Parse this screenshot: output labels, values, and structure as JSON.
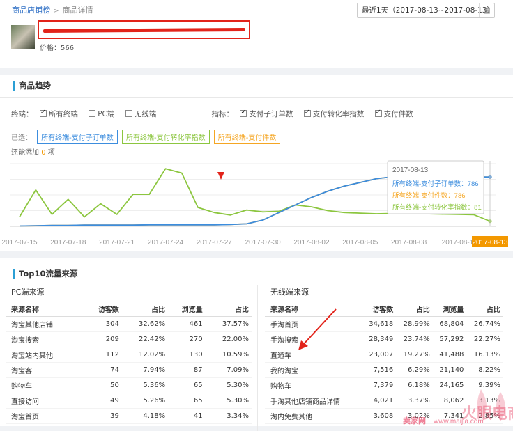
{
  "breadcrumb": {
    "root": "商品店铺榜",
    "current": "商品详情"
  },
  "date_range": "最近1天（2017-08-13~2017-08-13）",
  "product": {
    "price": "价格：566"
  },
  "trend": {
    "title": "商品趋势",
    "terminal_label": "终端：",
    "terminals": [
      {
        "label": "所有终端",
        "checked": true
      },
      {
        "label": "PC端",
        "checked": false
      },
      {
        "label": "无线端",
        "checked": false
      }
    ],
    "metric_label": "指标：",
    "metrics": [
      {
        "label": "支付子订单数",
        "checked": true
      },
      {
        "label": "支付转化率指数",
        "checked": true
      },
      {
        "label": "支付件数",
        "checked": true
      }
    ],
    "selected_label": "已选：",
    "selected": [
      {
        "label": "所有终端-支付子订单数",
        "color": "#3c8dde"
      },
      {
        "label": "所有终端-支付转化率指数",
        "color": "#8cc63f"
      },
      {
        "label": "所有终端-支付件数",
        "color": "#f5a623"
      }
    ],
    "addmore_prefix": "还能添加",
    "addmore_count": "0",
    "addmore_suffix": "项"
  },
  "chart_data": {
    "type": "line",
    "x": [
      "2017-07-15",
      "2017-07-16",
      "2017-07-17",
      "2017-07-18",
      "2017-07-19",
      "2017-07-20",
      "2017-07-21",
      "2017-07-22",
      "2017-07-23",
      "2017-07-24",
      "2017-07-25",
      "2017-07-26",
      "2017-07-27",
      "2017-07-28",
      "2017-07-29",
      "2017-07-30",
      "2017-07-31",
      "2017-08-01",
      "2017-08-02",
      "2017-08-03",
      "2017-08-04",
      "2017-08-05",
      "2017-08-06",
      "2017-08-07",
      "2017-08-08",
      "2017-08-09",
      "2017-08-10",
      "2017-08-11",
      "2017-08-12",
      "2017-08-13"
    ],
    "xticks": [
      "2017-07-15",
      "2017-07-18",
      "2017-07-21",
      "2017-07-24",
      "2017-07-27",
      "2017-07-30",
      "2017-08-02",
      "2017-08-05",
      "2017-08-08",
      "2017-08-1",
      "2017-08-13"
    ],
    "ylim": [
      0,
      1000
    ],
    "series": [
      {
        "name": "所有终端-支付子订单数",
        "color": "#3c8dde",
        "values": [
          5,
          10,
          15,
          15,
          20,
          20,
          20,
          20,
          25,
          25,
          25,
          25,
          25,
          30,
          40,
          100,
          220,
          340,
          460,
          560,
          640,
          700,
          760,
          790,
          800,
          800,
          790,
          790,
          790,
          786
        ]
      },
      {
        "name": "所有终端-支付件数",
        "color": "#f5a623",
        "values": [
          5,
          10,
          15,
          15,
          20,
          20,
          20,
          20,
          25,
          25,
          25,
          25,
          25,
          30,
          40,
          100,
          220,
          340,
          460,
          560,
          640,
          700,
          760,
          790,
          800,
          800,
          790,
          790,
          790,
          786
        ]
      },
      {
        "name": "所有终端-支付转化率指数",
        "color": "#8cc63f",
        "values": [
          150,
          580,
          190,
          430,
          150,
          360,
          190,
          510,
          510,
          920,
          850,
          300,
          220,
          180,
          260,
          230,
          240,
          340,
          310,
          250,
          220,
          210,
          200,
          205,
          210,
          200,
          195,
          190,
          185,
          81
        ]
      }
    ],
    "tooltip": {
      "date": "2017-08-13",
      "rows": [
        {
          "label": "所有终端-支付子订单数：786",
          "color": "#3c8dde"
        },
        {
          "label": "所有终端-支付件数：786",
          "color": "#f5a623"
        },
        {
          "label": "所有终端-支付转化率指数：81",
          "color": "#8cc63f"
        }
      ]
    }
  },
  "sources": {
    "title": "Top10流量来源",
    "pc": {
      "heading": "PC端来源",
      "columns": [
        "来源名称",
        "访客数",
        "占比",
        "浏览量",
        "占比"
      ],
      "rows": [
        [
          "淘宝其他店铺",
          "304",
          "32.62%",
          "461",
          "37.57%"
        ],
        [
          "淘宝搜索",
          "209",
          "22.42%",
          "270",
          "22.00%"
        ],
        [
          "淘宝站内其他",
          "112",
          "12.02%",
          "130",
          "10.59%"
        ],
        [
          "淘宝客",
          "74",
          "7.94%",
          "87",
          "7.09%"
        ],
        [
          "购物车",
          "50",
          "5.36%",
          "65",
          "5.30%"
        ],
        [
          "直接访问",
          "49",
          "5.26%",
          "65",
          "5.30%"
        ],
        [
          "淘宝首页",
          "39",
          "4.18%",
          "41",
          "3.34%"
        ]
      ]
    },
    "mobile": {
      "heading": "无线端来源",
      "columns": [
        "来源名称",
        "访客数",
        "占比",
        "浏览量",
        "占比"
      ],
      "rows": [
        [
          "手淘首页",
          "34,618",
          "28.99%",
          "68,804",
          "26.74%"
        ],
        [
          "手淘搜索",
          "28,349",
          "23.74%",
          "57,292",
          "22.27%"
        ],
        [
          "直通车",
          "23,007",
          "19.27%",
          "41,488",
          "16.13%"
        ],
        [
          "我的淘宝",
          "7,516",
          "6.29%",
          "21,140",
          "8.22%"
        ],
        [
          "购物车",
          "7,379",
          "6.18%",
          "24,165",
          "9.39%"
        ],
        [
          "手淘其他店铺商品详情",
          "4,021",
          "3.37%",
          "8,062",
          "3.13%"
        ],
        [
          "淘内免费其他",
          "3,608",
          "3.02%",
          "7,341",
          "2.85%"
        ]
      ]
    }
  },
  "watermark": {
    "text1": "卖家网",
    "text2": "www.maijia.com"
  }
}
